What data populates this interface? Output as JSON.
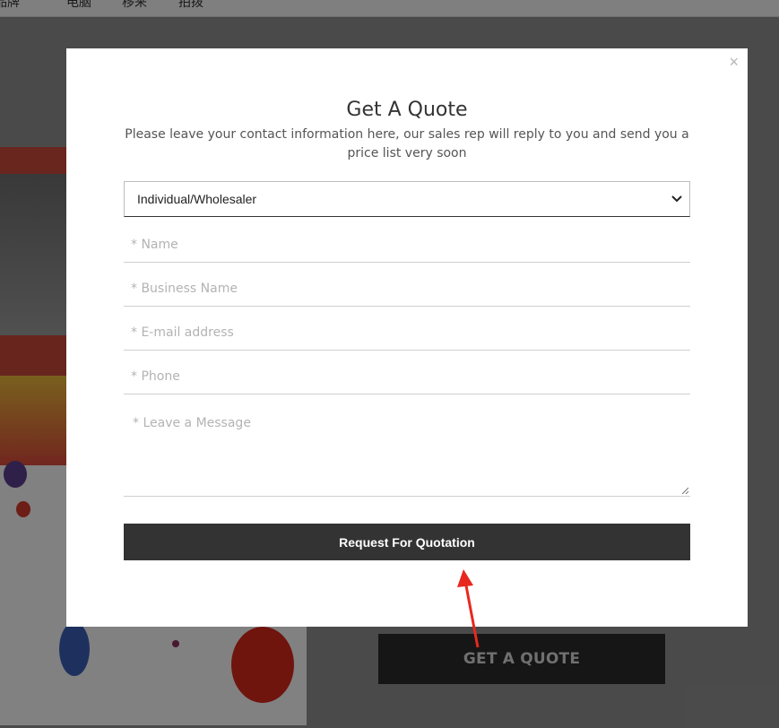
{
  "background": {
    "nav_items": [
      "品牌",
      "电脑",
      "移来",
      "拍拨"
    ],
    "cta_label": "GET A QUOTE",
    "overlay_color": "#000000"
  },
  "modal": {
    "close_symbol": "×",
    "title": "Get A Quote",
    "subtitle": "Please leave your contact information here, our sales rep will reply to you and send you a price list very soon",
    "customer_type": {
      "selected": "Individual/Wholesaler",
      "icon": "chevron-down-icon"
    },
    "fields": {
      "name_placeholder": "* Name",
      "business_placeholder": "* Business Name",
      "email_placeholder": "* E-mail address",
      "phone_placeholder": "* Phone",
      "message_placeholder": "* Leave a Message"
    },
    "submit_label": "Request For Quotation"
  },
  "annotation": {
    "arrow_color": "#e8281e"
  }
}
